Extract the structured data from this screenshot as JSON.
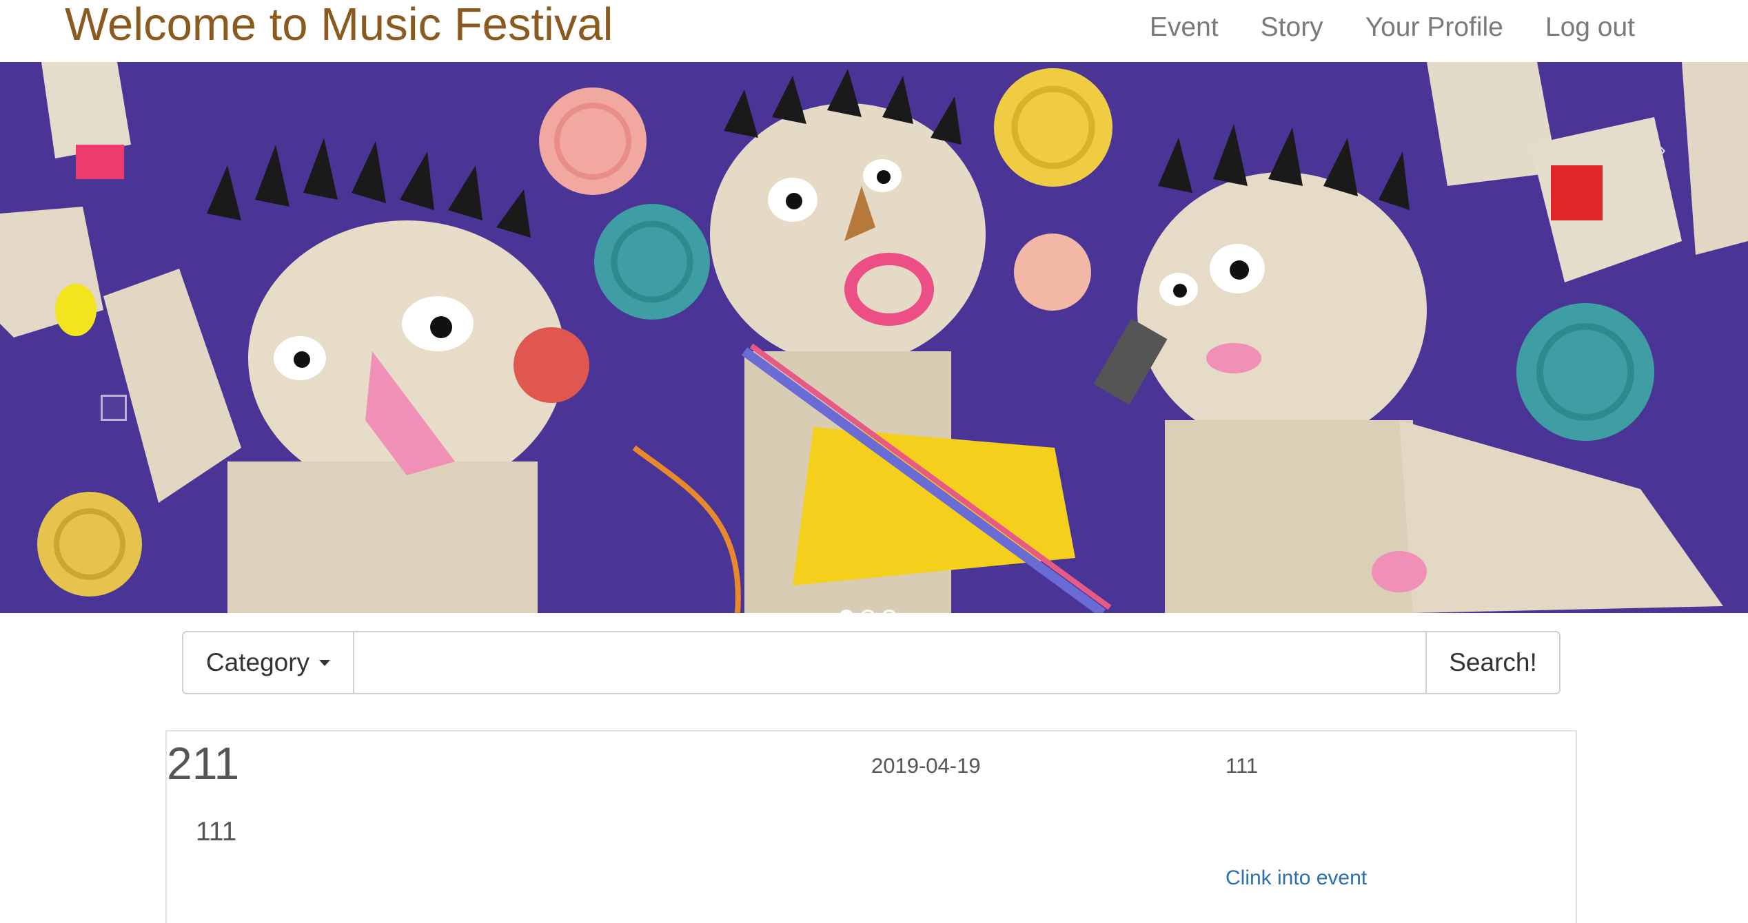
{
  "header": {
    "title": "Welcome to Music Festival",
    "nav": [
      "Event",
      "Story",
      "Your Profile",
      "Log out"
    ]
  },
  "carousel": {
    "image_description_icon": "paper-collage-band-image",
    "slide_count": 3,
    "active_slide": 1,
    "next_icon": "›"
  },
  "search": {
    "category_label": "Category",
    "input_value": "",
    "button_label": "Search!"
  },
  "event": {
    "title": "211",
    "description": "111",
    "date": "2019-04-19",
    "extra": "111",
    "link_label": "Clink into event"
  },
  "colors": {
    "brand": "#8a5a1f",
    "nav_text": "#7a7a7a",
    "link": "#2a6fb0",
    "carousel_bg": "#4a3596"
  }
}
